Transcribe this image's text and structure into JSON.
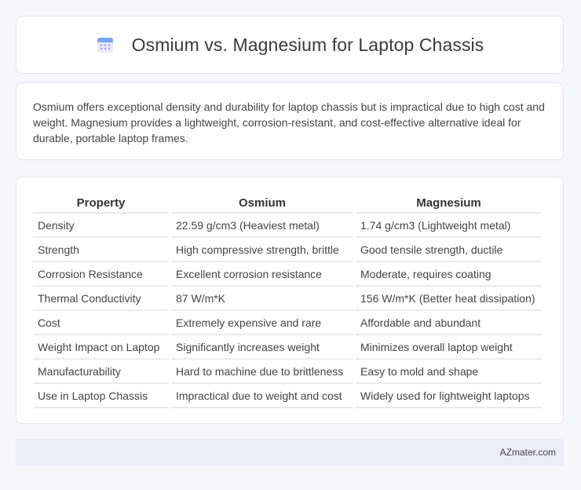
{
  "header": {
    "title": "Osmium vs. Magnesium for Laptop Chassis",
    "icon": "calendar-grid-icon",
    "icon_colors": {
      "top": "#7aa8f0",
      "body": "#e9ecfb",
      "dots": "#b9a6f2"
    }
  },
  "summary": {
    "text": "Osmium offers exceptional density and durability for laptop chassis but is impractical due to high cost and weight. Magnesium provides a lightweight, corrosion-resistant, and cost-effective alternative ideal for durable, portable laptop frames."
  },
  "table": {
    "headers": [
      "Property",
      "Osmium",
      "Magnesium"
    ],
    "rows": [
      [
        "Density",
        "22.59 g/cm3 (Heaviest metal)",
        "1.74 g/cm3 (Lightweight metal)"
      ],
      [
        "Strength",
        "High compressive strength, brittle",
        "Good tensile strength, ductile"
      ],
      [
        "Corrosion Resistance",
        "Excellent corrosion resistance",
        "Moderate, requires coating"
      ],
      [
        "Thermal Conductivity",
        "87 W/m*K",
        "156 W/m*K (Better heat dissipation)"
      ],
      [
        "Cost",
        "Extremely expensive and rare",
        "Affordable and abundant"
      ],
      [
        "Weight Impact on Laptop",
        "Significantly increases weight",
        "Minimizes overall laptop weight"
      ],
      [
        "Manufacturability",
        "Hard to machine due to brittleness",
        "Easy to mold and shape"
      ],
      [
        "Use in Laptop Chassis",
        "Impractical due to weight and cost",
        "Widely used for lightweight laptops"
      ]
    ]
  },
  "footer": {
    "credit": "AZmater.com"
  }
}
